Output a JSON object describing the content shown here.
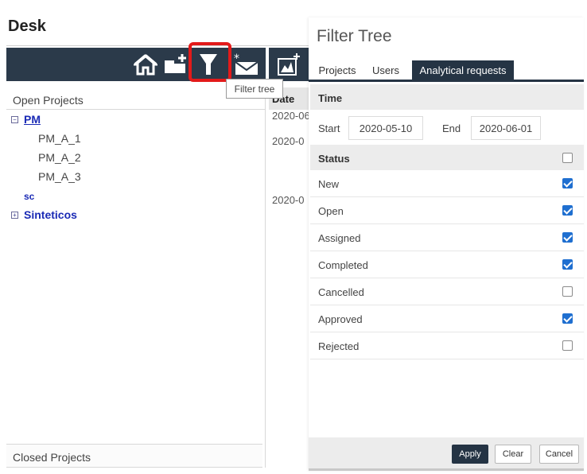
{
  "desk": {
    "title": "Desk",
    "tooltip": "Filter tree",
    "open_projects_label": "Open Projects",
    "closed_projects_label": "Closed Projects",
    "toolbar_icons": [
      "home-icon",
      "new-project-icon",
      "filter-icon",
      "new-request-icon",
      "new-chart-icon"
    ],
    "tree": {
      "node_pm": "PM",
      "pm_children": [
        "PM_A_1",
        "PM_A_2",
        "PM_A_3"
      ],
      "node_sc": "sc",
      "node_sinteticos": "Sinteticos"
    },
    "date_column": {
      "header": "Date",
      "values": [
        "2020-06",
        "2020-0",
        "2020-0"
      ]
    }
  },
  "filter": {
    "title": "Filter Tree",
    "tabs": [
      "Projects",
      "Users",
      "Analytical requests"
    ],
    "active_tab": "Analytical requests",
    "time_section": "Time",
    "start_label": "Start",
    "start_value": "2020-05-10",
    "end_label": "End",
    "end_value": "2020-06-01",
    "status_section": "Status",
    "statuses": [
      {
        "label": "New",
        "checked": true
      },
      {
        "label": "Open",
        "checked": true
      },
      {
        "label": "Assigned",
        "checked": true
      },
      {
        "label": "Completed",
        "checked": true
      },
      {
        "label": "Cancelled",
        "checked": false
      },
      {
        "label": "Approved",
        "checked": true
      },
      {
        "label": "Rejected",
        "checked": false
      }
    ],
    "buttons": {
      "apply": "Apply",
      "clear": "Clear",
      "cancel": "Cancel"
    }
  },
  "colors": {
    "toolbar_bg": "#2b3a4a",
    "tab_active": "#253444",
    "checkbox_on": "#1f6fd0",
    "highlight": "#e31a1a",
    "tree_link": "#1a2ab5"
  }
}
